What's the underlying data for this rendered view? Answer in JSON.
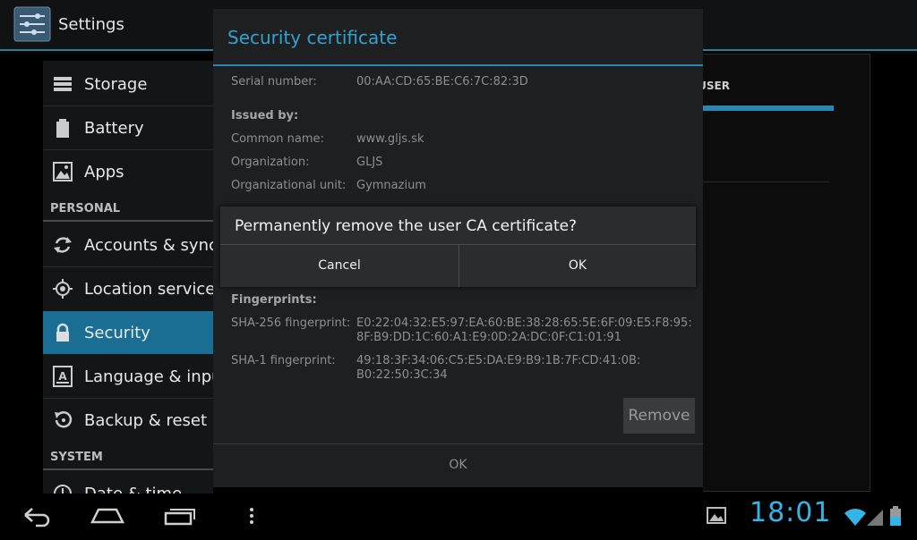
{
  "app": {
    "title": "Settings"
  },
  "sidebar": {
    "items": [
      {
        "label": "Storage",
        "icon": "storage-icon"
      },
      {
        "label": "Battery",
        "icon": "battery-icon"
      },
      {
        "label": "Apps",
        "icon": "apps-icon"
      },
      {
        "label": "Accounts & sync",
        "icon": "sync-icon"
      },
      {
        "label": "Location services",
        "icon": "location-icon"
      },
      {
        "label": "Security",
        "icon": "lock-icon",
        "active": true
      },
      {
        "label": "Language & input",
        "icon": "language-icon"
      },
      {
        "label": "Backup & reset",
        "icon": "backup-icon"
      },
      {
        "label": "Date & time",
        "icon": "clock-icon"
      }
    ],
    "headers": {
      "personal": "PERSONAL",
      "system": "SYSTEM"
    }
  },
  "right_panel": {
    "tab_label": "USER"
  },
  "cert_dialog": {
    "title": "Security certificate",
    "serial_label": "Serial number:",
    "serial_value": "00:AA:CD:65:BE:C6:7C:82:3D",
    "issued_by": "Issued by:",
    "common_name_label": "Common name:",
    "common_name_value": "www.gljs.sk",
    "org_label": "Organization:",
    "org_value": "GLJS",
    "org_unit_label": "Organizational unit:",
    "org_unit_value": "Gymnazium",
    "fingerprints": "Fingerprints:",
    "sha256_label": "SHA-256 fingerprint:",
    "sha256_value_1": "E0:22:04:32:E5:97:EA:60:BE:38:28:65:5E:6F:09:E5:F8:95:",
    "sha256_value_2": "8F:B9:DD:1C:60:A1:E9:0D:2A:DC:0F:C1:01:91",
    "sha1_label": "SHA-1 fingerprint:",
    "sha1_value_1": "49:18:3F:34:06:C5:E5:DA:E9:B9:1B:7F:CD:41:0B:",
    "sha1_value_2": "B0:22:50:3C:34",
    "remove_label": "Remove",
    "ok_label": "OK"
  },
  "confirm_dialog": {
    "message": "Permanently remove the user CA certificate?",
    "cancel_label": "Cancel",
    "ok_label": "OK"
  },
  "status": {
    "time": "18:01"
  },
  "colors": {
    "accent": "#33b5e5",
    "active": "#1a6e93"
  }
}
